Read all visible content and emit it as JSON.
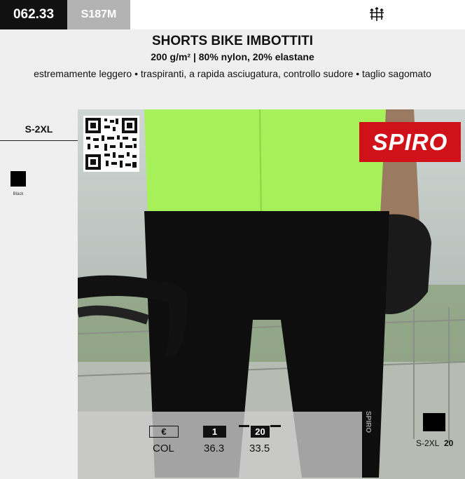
{
  "header": {
    "code": "062.33",
    "ref": "S187M",
    "title": "SHORTS BIKE IMBOTTITI",
    "subtitle": "200 g/m² | 80% nylon, 20% elastane",
    "features": "estremamente leggero • traspiranti, a rapida asciugatura, controllo sudore • taglio sagomato"
  },
  "top_icon": "fiber-icon",
  "sidebar": {
    "size_range": "S-2XL",
    "colors": [
      {
        "name": "Black",
        "hex": "#000000"
      }
    ]
  },
  "brand": {
    "name": "SPIRO",
    "color": "#d0111a"
  },
  "photo": {
    "jersey_color": "#a6f15a",
    "shorts_color": "#0e0e0e",
    "short_logo_text": "SPIRO"
  },
  "pricing": {
    "currency": "€",
    "col_label": "COL",
    "qty_1": "1",
    "qty_20": "20",
    "price_1": "36.3",
    "price_20": "33.5"
  },
  "pack": {
    "size": "S-2XL",
    "qty": "20"
  }
}
